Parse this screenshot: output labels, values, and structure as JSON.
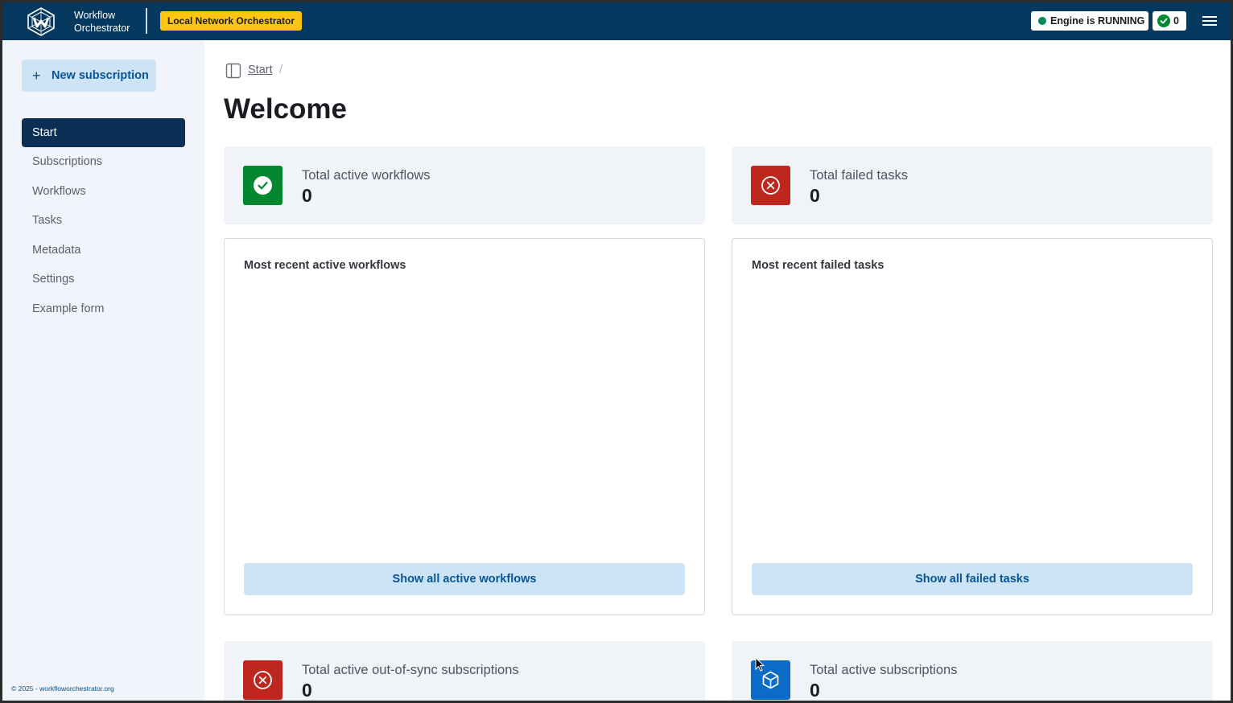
{
  "header": {
    "brand_line1": "Workflow",
    "brand_line2": "Orchestrator",
    "environment": "Local Network Orchestrator",
    "engine_status": "Engine is RUNNING",
    "engine_status_color": "#008a5e",
    "process_count": "0",
    "colors": {
      "header_bg": "#04385f",
      "env_badge": "#fec514"
    }
  },
  "sidebar": {
    "new_subscription_label": "New subscription",
    "items": [
      {
        "label": "Start",
        "active": true
      },
      {
        "label": "Subscriptions"
      },
      {
        "label": "Workflows"
      },
      {
        "label": "Tasks"
      },
      {
        "label": "Metadata"
      },
      {
        "label": "Settings"
      },
      {
        "label": "Example form"
      }
    ],
    "footer": "© 2025 - workfloworchestrator.org"
  },
  "main": {
    "breadcrumb": {
      "link": "Start",
      "separator": "/"
    },
    "title": "Welcome",
    "stats": {
      "active_workflows": {
        "label": "Total active workflows",
        "value": "0",
        "icon": "check-circle-icon",
        "color": "#00872f"
      },
      "failed_tasks": {
        "label": "Total failed tasks",
        "value": "0",
        "icon": "x-circle-icon",
        "color": "#bd271e"
      },
      "out_of_sync": {
        "label": "Total active out-of-sync subscriptions",
        "value": "0",
        "icon": "x-circle-icon",
        "color": "#bd271e"
      },
      "active_subscriptions": {
        "label": "Total active subscriptions",
        "value": "0",
        "icon": "cube-icon",
        "color": "#0b6cc7"
      }
    },
    "lists": {
      "recent_workflows": {
        "title": "Most recent active workflows",
        "button": "Show all active workflows"
      },
      "recent_failed": {
        "title": "Most recent failed tasks",
        "button": "Show all failed tasks"
      }
    }
  }
}
